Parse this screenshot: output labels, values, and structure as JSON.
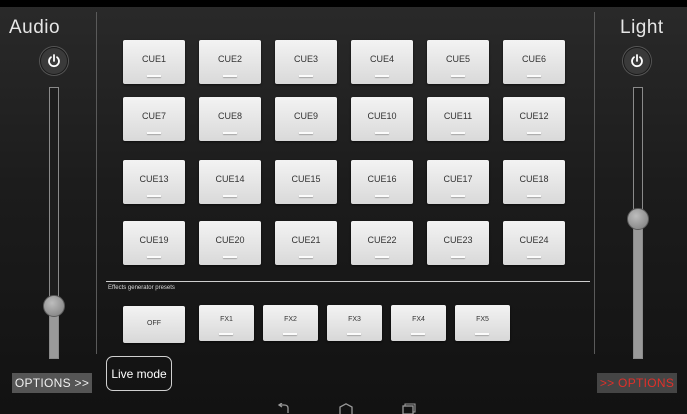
{
  "audio": {
    "title": "Audio",
    "options_label": "OPTIONS >>",
    "slider_level": 0.19
  },
  "light": {
    "title": "Light",
    "options_label": ">> OPTIONS",
    "slider_level": 0.51
  },
  "colors": {
    "accent_red": "#e0302a",
    "cue_button": "#e6e6e6",
    "background": "#1c1c1c"
  },
  "cues": [
    "CUE1",
    "CUE2",
    "CUE3",
    "CUE4",
    "CUE5",
    "CUE6",
    "CUE7",
    "CUE8",
    "CUE9",
    "CUE10",
    "CUE11",
    "CUE12",
    "CUE13",
    "CUE14",
    "CUE15",
    "CUE16",
    "CUE17",
    "CUE18",
    "CUE19",
    "CUE20",
    "CUE21",
    "CUE22",
    "CUE23",
    "CUE24"
  ],
  "effects": {
    "caption": "Effects generator presets",
    "off_label": "OFF",
    "presets": [
      "FX1",
      "FX2",
      "FX3",
      "FX4",
      "FX5"
    ]
  },
  "live_mode_label": "Live mode",
  "navbar": {
    "icons": [
      "back-icon",
      "home-icon",
      "recents-icon"
    ]
  }
}
